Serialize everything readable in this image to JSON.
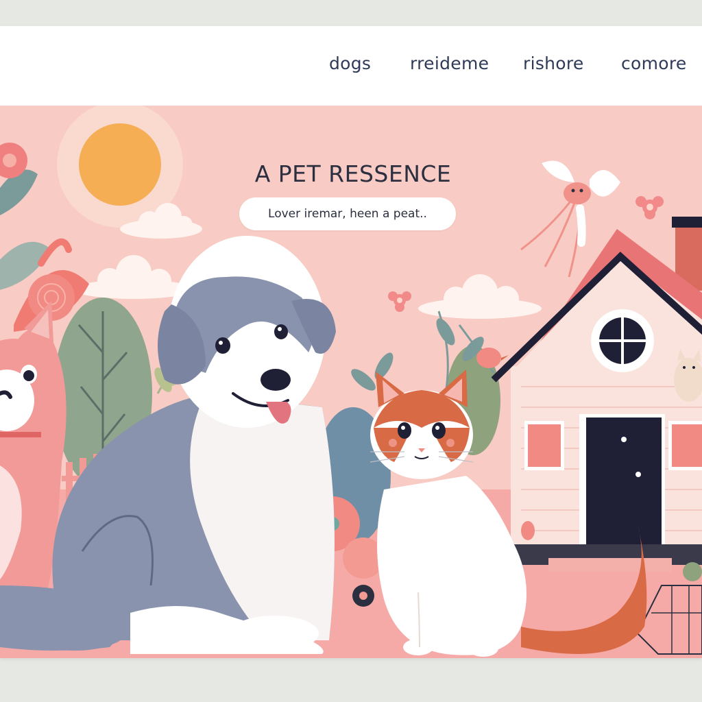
{
  "nav": {
    "items": [
      {
        "label": "dogs"
      },
      {
        "label": "rreideme"
      },
      {
        "label": "rishore"
      },
      {
        "label": "comore"
      }
    ]
  },
  "hero": {
    "headline": "A PET RESSENCE",
    "tagline": "Lover iremar, heen a peat.."
  },
  "illustration": {
    "subjects": [
      "grey-white-dog",
      "orange-white-cat",
      "pink-cat",
      "house",
      "sun",
      "bird",
      "flowers",
      "trees"
    ]
  },
  "colors": {
    "hero_background": "#f7c7c1",
    "nav_text": "#2e3a57",
    "dog_grey": "#8a93ad",
    "cat_orange": "#d86a45",
    "sun": "#f6ae55",
    "house_roof": "#e87475",
    "door": "#1f1f35"
  }
}
